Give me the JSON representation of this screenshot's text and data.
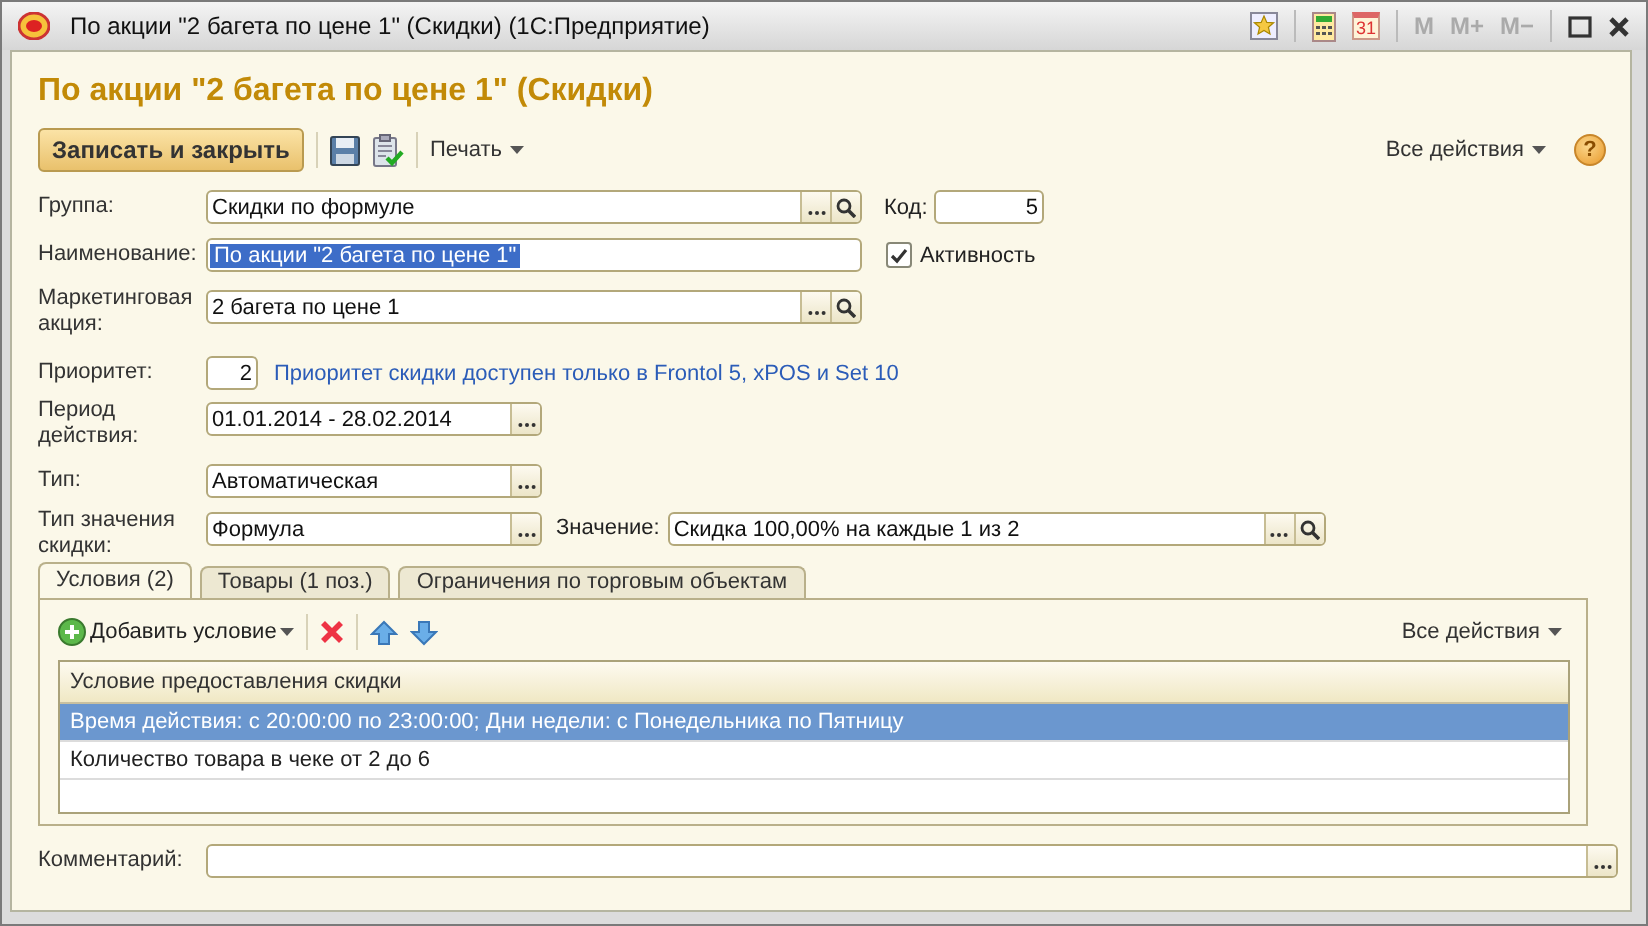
{
  "window": {
    "title": "По акции \"2 багета по цене 1\" (Скидки)  (1С:Предприятие)",
    "calendar_day": "31",
    "memory_keys": [
      "M",
      "M+",
      "M−"
    ]
  },
  "form": {
    "heading": "По акции \"2 багета по цене 1\" (Скидки)",
    "save_close": "Записать и закрыть",
    "print": "Печать",
    "all_actions": "Все действия",
    "help": "?"
  },
  "group": {
    "label": "Группа:",
    "value": "Скидки по формуле"
  },
  "code": {
    "label": "Код:",
    "value": "5"
  },
  "name": {
    "label": "Наименование:",
    "value": "По акции \"2 багета по цене 1\"",
    "text_selected": true
  },
  "active": {
    "label": "Активность",
    "checked": true
  },
  "campaign": {
    "label": "Маркетинговая акция:",
    "value": "2 багета по цене 1"
  },
  "priority": {
    "label": "Приоритет:",
    "value": "2",
    "note": "Приоритет скидки доступен только в Frontol 5, xPOS и Set 10"
  },
  "period": {
    "label": "Период действия:",
    "value": "01.01.2014 - 28.02.2014"
  },
  "type": {
    "label": "Тип:",
    "value": "Автоматическая"
  },
  "value_type": {
    "label": "Тип значения скидки:",
    "value": "Формула"
  },
  "value": {
    "label": "Значение:",
    "value": "Скидка 100,00% на каждые 1 из 2"
  },
  "tabs": [
    {
      "label": "Условия (2)",
      "selected": true
    },
    {
      "label": "Товары (1 поз.)",
      "selected": false
    },
    {
      "label": "Ограничения по торговым объектам",
      "selected": false
    }
  ],
  "conditions": {
    "add": "Добавить условие",
    "all_actions": "Все действия",
    "column": "Условие предоставления скидки",
    "rows": [
      {
        "text": "Время действия: с 20:00:00 по 23:00:00; Дни недели: с Понедельника по Пятницу",
        "selected": true
      },
      {
        "text": "Количество товара в чеке от 2 до 6",
        "selected": false
      }
    ]
  },
  "comment": {
    "label": "Комментарий:"
  }
}
